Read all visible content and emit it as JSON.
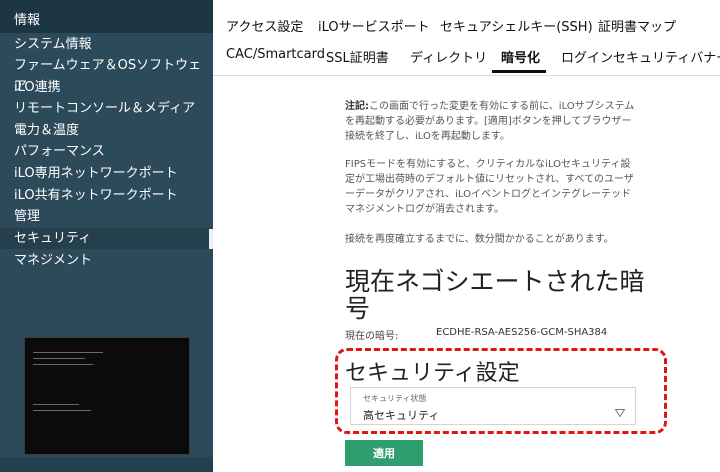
{
  "sidebar": {
    "header": "情報",
    "items": [
      {
        "label": "システム情報"
      },
      {
        "label": "ファームウェア＆OSソフトウェア"
      },
      {
        "label": "iLO連携"
      },
      {
        "label": "リモートコンソール＆メディア"
      },
      {
        "label": "電力＆温度"
      },
      {
        "label": "パフォーマンス"
      },
      {
        "label": "iLO専用ネットワークポート"
      },
      {
        "label": "iLO共有ネットワークポート"
      },
      {
        "label": "管理"
      },
      {
        "label": "セキュリティ",
        "active": true
      },
      {
        "label": "マネジメント"
      }
    ]
  },
  "tabs": {
    "row1": [
      "アクセス設定",
      "iLOサービスポート",
      "セキュアシェルキー(SSH)",
      "証明書マップ"
    ],
    "row2": [
      "CAC/Smartcard",
      "SSL証明書",
      "ディレクトリ",
      "暗号化",
      "ログインセキュリティバナー"
    ],
    "active": "暗号化"
  },
  "notes": {
    "note1_prefix": "注記:",
    "note1_body": "この画面で行った変更を有効にする前に、iLOサブシステムを再起動する必要があります。[適用]ボタンを押してブラウザー接続を終了し、iLOを再起動します。",
    "note2": "FIPSモードを有効にすると、クリティカルなiLOセキュリティ設定が工場出荷時のデフォルト値にリセットされ、すべてのユーザーデータがクリアされ、iLOイベントログとインテグレーテッドマネジメントログが消去されます。",
    "note3": "接続を再度確立するまでに、数分間かかることがあります。"
  },
  "cipher": {
    "title": "現在ネゴシエートされた暗号",
    "label": "現在の暗号:",
    "value": "ECDHE-RSA-AES256-GCM-SHA384"
  },
  "security": {
    "title": "セキュリティ設定",
    "state_label": "セキュリティ状態",
    "state_value": "高セキュリティ"
  },
  "apply_label": "適用",
  "colors": {
    "sidebar_bg": "#2c4a5a",
    "apply_green": "#2f9e6e",
    "highlight_red": "#e01515"
  }
}
